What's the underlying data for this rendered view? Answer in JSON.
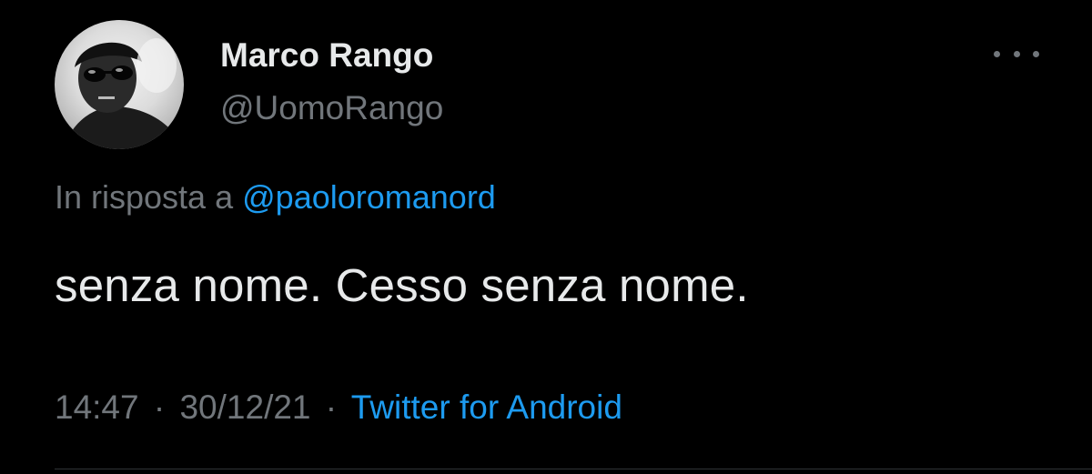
{
  "tweet": {
    "author": {
      "display_name": "Marco Rango",
      "handle": "@UomoRango"
    },
    "reply_prefix": "In risposta a",
    "reply_to": "@paoloromanord",
    "text": "senza nome. Cesso senza nome.",
    "time": "14:47",
    "date": "30/12/21",
    "separator": "·",
    "source": "Twitter for Android"
  },
  "colors": {
    "background": "#000000",
    "primary_text": "#e7e9ea",
    "secondary_text": "#71767b",
    "accent": "#1d9bf0"
  },
  "icons": {
    "more": "more-horizontal-icon"
  }
}
